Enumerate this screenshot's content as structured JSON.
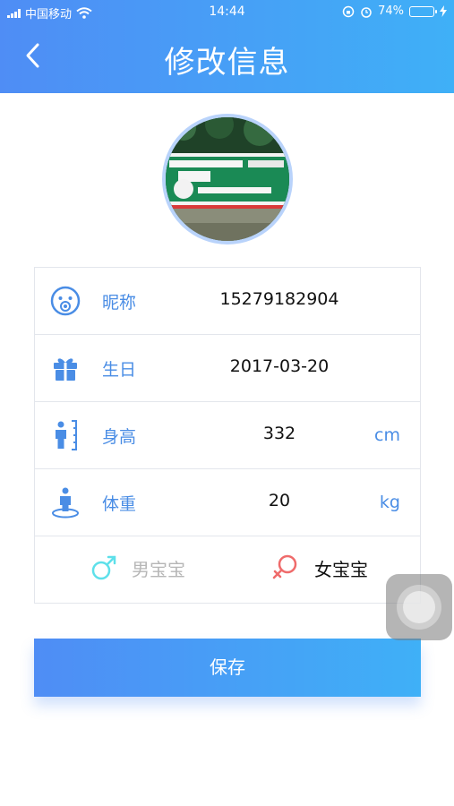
{
  "status_bar": {
    "carrier": "中国移动",
    "time": "14:44",
    "battery_percent": "74%",
    "battery_level": 0.74
  },
  "header": {
    "title": "修改信息"
  },
  "form": {
    "nickname": {
      "label": "昵称",
      "value": "15279182904"
    },
    "birthday": {
      "label": "生日",
      "value": "2017-03-20"
    },
    "height": {
      "label": "身高",
      "value": "332",
      "unit": "cm"
    },
    "weight": {
      "label": "体重",
      "value": "20",
      "unit": "kg"
    },
    "gender": {
      "male_label": "男宝宝",
      "female_label": "女宝宝",
      "selected": "female"
    }
  },
  "save_button": {
    "label": "保存"
  },
  "colors": {
    "primary": "#4f8df5",
    "secondary": "#3fb0f7",
    "male": "#5ee0ea",
    "female": "#ef6b6b"
  }
}
